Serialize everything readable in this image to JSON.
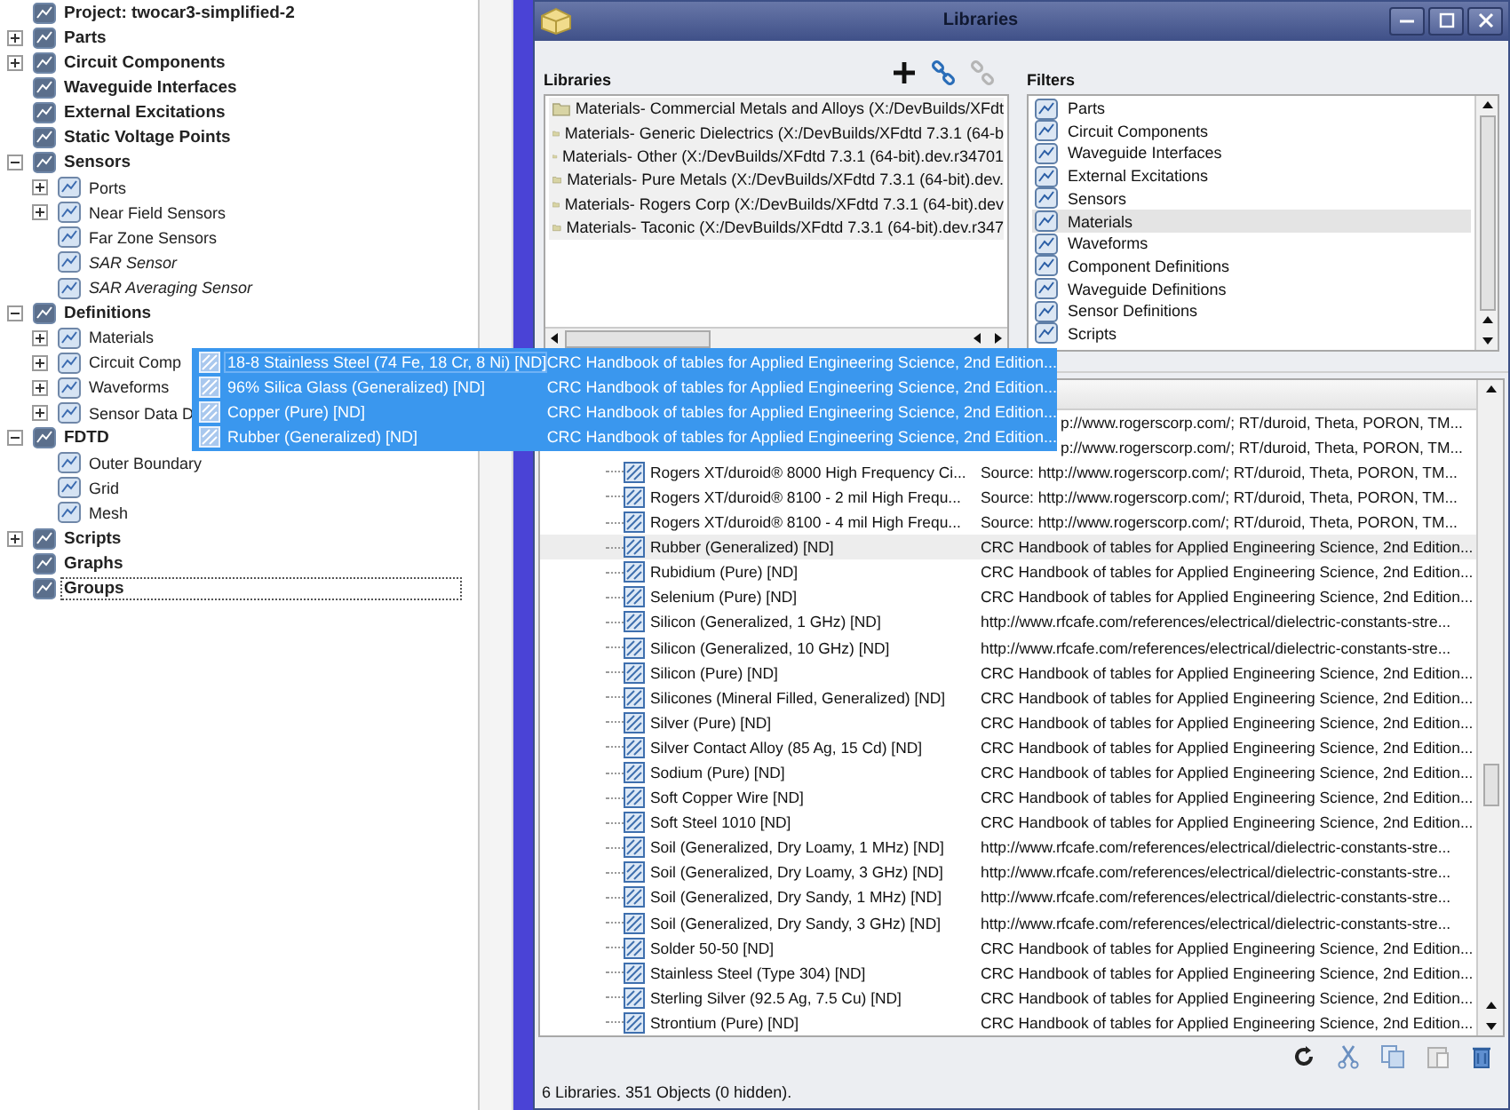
{
  "tree": {
    "root": {
      "label": "Project: twocar3-simplified-2",
      "children": [
        {
          "label": "Parts",
          "expanded": false
        },
        {
          "label": "Circuit Components",
          "expanded": false
        },
        {
          "label": "Waveguide Interfaces"
        },
        {
          "label": "External Excitations"
        },
        {
          "label": "Static Voltage Points"
        },
        {
          "label": "Sensors",
          "expanded": true,
          "children": [
            {
              "label": "Ports",
              "expanded": false
            },
            {
              "label": "Near Field Sensors",
              "expanded": false
            },
            {
              "label": "Far Zone Sensors"
            },
            {
              "label": "SAR Sensor",
              "italic": true
            },
            {
              "label": "SAR Averaging Sensor",
              "italic": true
            }
          ]
        },
        {
          "label": "Definitions",
          "expanded": true,
          "children": [
            {
              "label": "Materials",
              "expanded": false
            },
            {
              "label": "Circuit Comp",
              "expanded": false
            },
            {
              "label": "Waveforms",
              "expanded": false
            },
            {
              "label": "Sensor Data D",
              "expanded": false
            }
          ]
        },
        {
          "label": "FDTD",
          "expanded": true,
          "children": [
            {
              "label": "Outer Boundary"
            },
            {
              "label": "Grid"
            },
            {
              "label": "Mesh"
            }
          ]
        },
        {
          "label": "Scripts",
          "expanded": false
        },
        {
          "label": "Graphs"
        },
        {
          "label": "Groups",
          "focused": true
        }
      ]
    }
  },
  "dialog": {
    "title": "Libraries",
    "libraries": {
      "label": "Libraries",
      "items": [
        "Materials- Commercial Metals and Alloys (X:/DevBuilds/XFdt",
        "Materials- Generic Dielectrics (X:/DevBuilds/XFdtd 7.3.1 (64-b",
        "Materials- Other (X:/DevBuilds/XFdtd 7.3.1 (64-bit).dev.r34701",
        "Materials- Pure Metals (X:/DevBuilds/XFdtd 7.3.1 (64-bit).dev.",
        "Materials- Rogers Corp (X:/DevBuilds/XFdtd 7.3.1 (64-bit).dev",
        "Materials- Taconic (X:/DevBuilds/XFdtd 7.3.1 (64-bit).dev.r347"
      ]
    },
    "filters": {
      "label": "Filters",
      "items": [
        {
          "label": "Parts",
          "selected": false
        },
        {
          "label": "Circuit Components",
          "selected": false
        },
        {
          "label": "Waveguide Interfaces",
          "selected": false
        },
        {
          "label": "External Excitations",
          "selected": false
        },
        {
          "label": "Sensors",
          "selected": false
        },
        {
          "label": "Materials",
          "selected": true
        },
        {
          "label": "Waveforms",
          "selected": false
        },
        {
          "label": "Component Definitions",
          "selected": false
        },
        {
          "label": "Waveguide Definitions",
          "selected": false
        },
        {
          "label": "Sensor Definitions",
          "selected": false
        },
        {
          "label": "Scripts",
          "selected": false
        }
      ]
    },
    "table": {
      "rows": [
        {
          "source": "p://www.rogerscorp.com/; RT/duroid, Theta, PORON, TM...",
          "selected": false
        },
        {
          "source": "p://www.rogerscorp.com/; RT/duroid, Theta, PORON, TM...",
          "selected": false
        },
        {
          "name": "Rogers XT/duroid® 8000 High Frequency Ci...",
          "source": "Source: http://www.rogerscorp.com/; RT/duroid, Theta, PORON, TM...",
          "selected": false
        },
        {
          "name": "Rogers XT/duroid® 8100 - 2 mil High Frequ...",
          "source": "Source: http://www.rogerscorp.com/; RT/duroid, Theta, PORON, TM...",
          "selected": false
        },
        {
          "name": "Rogers XT/duroid® 8100 - 4 mil High Frequ...",
          "source": "Source: http://www.rogerscorp.com/; RT/duroid, Theta, PORON, TM...",
          "selected": false
        },
        {
          "name": "Rubber (Generalized) [ND]",
          "source": "CRC Handbook of tables for Applied Engineering Science, 2nd Edition...",
          "selected": true
        },
        {
          "name": "Rubidium (Pure) [ND]",
          "source": "CRC Handbook of tables for Applied Engineering Science, 2nd Edition...",
          "selected": false
        },
        {
          "name": "Selenium (Pure) [ND]",
          "source": "CRC Handbook of tables for Applied Engineering Science, 2nd Edition...",
          "selected": false
        },
        {
          "name": "Silicon (Generalized, 1 GHz) [ND]",
          "source": "http://www.rfcafe.com/references/electrical/dielectric-constants-stre...",
          "selected": false
        },
        {
          "name": "Silicon (Generalized, 10 GHz) [ND]",
          "source": "http://www.rfcafe.com/references/electrical/dielectric-constants-stre...",
          "selected": false
        },
        {
          "name": "Silicon (Pure) [ND]",
          "source": "CRC Handbook of tables for Applied Engineering Science, 2nd Edition...",
          "selected": false
        },
        {
          "name": "Silicones (Mineral Filled, Generalized) [ND]",
          "source": "CRC Handbook of tables for Applied Engineering Science, 2nd Edition...",
          "selected": false
        },
        {
          "name": "Silver (Pure) [ND]",
          "source": "CRC Handbook of tables for Applied Engineering Science, 2nd Edition...",
          "selected": false
        },
        {
          "name": "Silver Contact Alloy (85 Ag, 15 Cd) [ND]",
          "source": "CRC Handbook of tables for Applied Engineering Science, 2nd Edition...",
          "selected": false
        },
        {
          "name": "Sodium (Pure) [ND]",
          "source": "CRC Handbook of tables for Applied Engineering Science, 2nd Edition...",
          "selected": false
        },
        {
          "name": "Soft Copper Wire [ND]",
          "source": "CRC Handbook of tables for Applied Engineering Science, 2nd Edition...",
          "selected": false
        },
        {
          "name": "Soft Steel 1010 [ND]",
          "source": "CRC Handbook of tables for Applied Engineering Science, 2nd Edition...",
          "selected": false
        },
        {
          "name": "Soil (Generalized, Dry Loamy, 1 MHz) [ND]",
          "source": "http://www.rfcafe.com/references/electrical/dielectric-constants-stre...",
          "selected": false
        },
        {
          "name": "Soil (Generalized, Dry Loamy, 3 GHz) [ND]",
          "source": "http://www.rfcafe.com/references/electrical/dielectric-constants-stre...",
          "selected": false
        },
        {
          "name": "Soil (Generalized, Dry Sandy, 1 MHz) [ND]",
          "source": "http://www.rfcafe.com/references/electrical/dielectric-constants-stre...",
          "selected": false
        },
        {
          "name": "Soil (Generalized, Dry Sandy, 3 GHz) [ND]",
          "source": "http://www.rfcafe.com/references/electrical/dielectric-constants-stre...",
          "selected": false
        },
        {
          "name": "Solder 50-50 [ND]",
          "source": "CRC Handbook of tables for Applied Engineering Science, 2nd Edition...",
          "selected": false
        },
        {
          "name": "Stainless Steel (Type 304) [ND]",
          "source": "CRC Handbook of tables for Applied Engineering Science, 2nd Edition...",
          "selected": false
        },
        {
          "name": "Sterling Silver (92.5 Ag, 7.5 Cu) [ND]",
          "source": "CRC Handbook of tables for Applied Engineering Science, 2nd Edition...",
          "selected": false
        },
        {
          "name": "Strontium (Pure) [ND]",
          "source": "CRC Handbook of tables for Applied Engineering Science, 2nd Edition...",
          "selected": false
        }
      ]
    },
    "status_bar": "6 Libraries. 351 Objects (0 hidden)."
  },
  "drag_preview": {
    "rows": [
      {
        "name": "18-8 Stainless Steel (74 Fe, 18 Cr, 8 Ni) [ND]",
        "source": "CRC Handbook of tables for Applied Engineering Science, 2nd Edition...",
        "focused": true
      },
      {
        "name": "96% Silica Glass (Generalized) [ND]",
        "source": "CRC Handbook of tables for Applied Engineering Science, 2nd Edition...",
        "focused": false
      },
      {
        "name": "Copper (Pure) [ND]",
        "source": "CRC Handbook of tables for Applied Engineering Science, 2nd Edition...",
        "focused": false
      },
      {
        "name": "Rubber (Generalized) [ND]",
        "source": "CRC Handbook of tables for Applied Engineering Science, 2nd Edition...",
        "focused": false
      }
    ]
  }
}
